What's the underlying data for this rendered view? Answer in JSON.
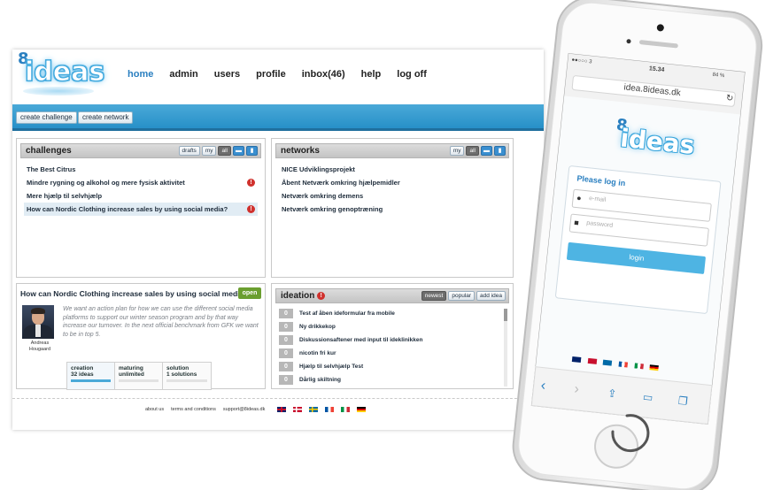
{
  "site": {
    "logo_digit": "8",
    "logo_word": "ideas",
    "nav": [
      {
        "label": "home",
        "active": true
      },
      {
        "label": "admin",
        "active": false
      },
      {
        "label": "users",
        "active": false
      },
      {
        "label": "profile",
        "active": false
      },
      {
        "label": "inbox(46)",
        "active": false
      },
      {
        "label": "help",
        "active": false
      },
      {
        "label": "log off",
        "active": false
      }
    ],
    "actions": {
      "create_challenge": "create challenge",
      "create_network": "create network"
    },
    "challenges": {
      "title": "challenges",
      "filters": [
        "drafts",
        "my",
        "all"
      ],
      "items": [
        {
          "label": "The Best Citrus",
          "alert": false,
          "highlight": false
        },
        {
          "label": "Mindre rygning og alkohol og mere fysisk aktivitet",
          "alert": true,
          "highlight": false
        },
        {
          "label": "Mere hjælp til selvhjælp",
          "alert": false,
          "highlight": false
        },
        {
          "label": "How can Nordic Clothing increase sales by using social media?",
          "alert": true,
          "highlight": true
        }
      ]
    },
    "networks": {
      "title": "networks",
      "filters": [
        "my",
        "all"
      ],
      "items": [
        {
          "label": "NICE Udviklingsprojekt"
        },
        {
          "label": "Åbent Netværk omkring hjælpemidler"
        },
        {
          "label": "Netværk omkring demens"
        },
        {
          "label": "Netværk omkring genoptræning"
        }
      ]
    },
    "detail": {
      "title": "How can Nordic Clothing increase sales by using social media?",
      "open_label": "open",
      "author_first": "Andreas",
      "author_last": "Hougaard",
      "description": "We want an action plan for how we can use the different social media platforms to support our winter season program and by that way increase our turnover. In the next official benchmark from GFK we want to be in top 5.",
      "stages": [
        {
          "name": "creation",
          "value": "32 ideas",
          "active": true
        },
        {
          "name": "maturing",
          "value": "unlimited",
          "active": false
        },
        {
          "name": "solution",
          "value": "1 solutions",
          "active": false
        }
      ]
    },
    "ideation": {
      "title": "ideation",
      "tabs": [
        "newest",
        "popular",
        "add idea"
      ],
      "items": [
        {
          "votes": "0",
          "label": "Test af åben ideformular fra mobile"
        },
        {
          "votes": "0",
          "label": "Ny drikkekop"
        },
        {
          "votes": "0",
          "label": "Diskussionsaftener med input til ideklinikken"
        },
        {
          "votes": "0",
          "label": "nicotin fri kur"
        },
        {
          "votes": "0",
          "label": "Hjælp til selvhjælp Test"
        },
        {
          "votes": "0",
          "label": "Dårlig skiltning"
        }
      ]
    },
    "footer": {
      "about": "about us",
      "terms": "terms and conditions",
      "email": "support@8ideas.dk"
    }
  },
  "phone": {
    "carrier": "●●○○○ 3",
    "time": "15.34",
    "battery": "84 %",
    "url": "idea.8ideas.dk",
    "logo_digit": "8",
    "logo_word": "ideas",
    "login_title": "Please log in",
    "email_placeholder": "e-mail",
    "password_placeholder": "password",
    "login_button": "login"
  },
  "colors": {
    "accent": "#2a7fc0",
    "bar": "#2790c8",
    "open": "#6a9e2f",
    "alert": "#d0312d"
  }
}
